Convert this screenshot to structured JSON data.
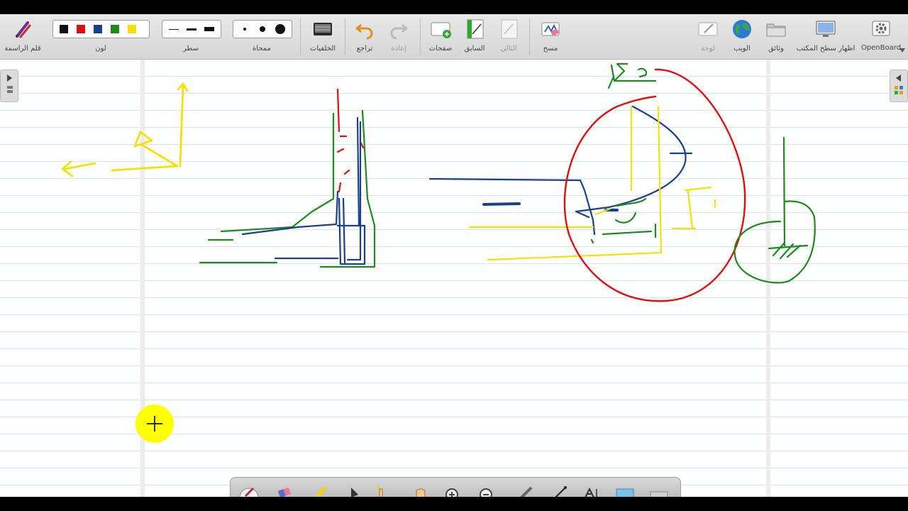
{
  "toolbar": {
    "pen": {
      "label": "قلم الراسمة",
      "icon": "pen-icon"
    },
    "color": {
      "label": "لون",
      "swatches": [
        "#111111",
        "#e01010",
        "#1a3f8f",
        "#1e8a1e",
        "#f2e20a"
      ]
    },
    "line": {
      "label": "سطر"
    },
    "eraser": {
      "label": "ممحاة"
    },
    "backgrounds": {
      "label": "الخلفيات",
      "icon": "keyboard-icon"
    },
    "undo": {
      "label": "تراجع",
      "icon": "undo-icon"
    },
    "redo": {
      "label": "إعادة",
      "icon": "redo-icon"
    },
    "pages": {
      "label": "صفحات",
      "icon": "add-page-icon"
    },
    "previous": {
      "label": "السابق",
      "icon": "previous-page-icon"
    },
    "next": {
      "label": "التالي",
      "icon": "next-page-icon"
    },
    "erase_all": {
      "label": "مسح",
      "icon": "clear-icon"
    },
    "board": {
      "label": "لوحة",
      "icon": "board-icon"
    },
    "web": {
      "label": "الويب",
      "icon": "globe-icon"
    },
    "documents": {
      "label": "وثائق",
      "icon": "folder-icon"
    },
    "desktop": {
      "label": "اظهار سطح المكتب",
      "icon": "desktop-icon"
    },
    "openboard": {
      "label": "OpenBoard",
      "icon": "gear-icon"
    }
  },
  "colors": {
    "red": "#e01010",
    "green": "#1e8a1e",
    "blue": "#1a3f8f",
    "yellow": "#f2e20a"
  }
}
